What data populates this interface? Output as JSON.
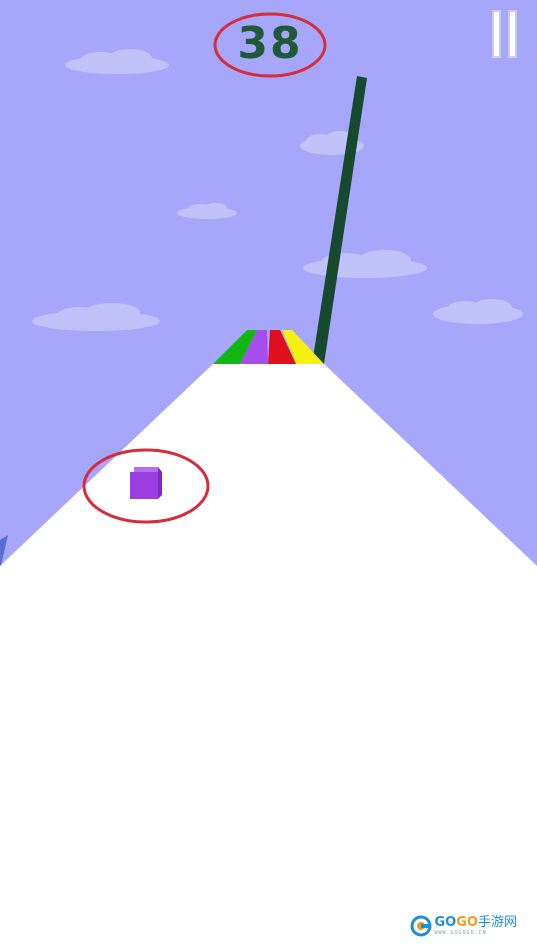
{
  "hud": {
    "score": "38",
    "score_color": "#1e5a3a",
    "highlight_color": "#d62d3a"
  },
  "colors": {
    "sky": "#a6a6fa",
    "cloud": "#c2c2fb",
    "track": "#ffffff",
    "pole": "#17492e",
    "player_cube": "#9b3de0",
    "lanes": [
      "#12b812",
      "#a54ded",
      "#e00f1e",
      "#f7f015"
    ]
  },
  "player": {
    "color_name": "purple"
  },
  "watermark": {
    "go_left": "GO",
    "go_right": "GO",
    "site_cn": "手游网",
    "sub": "WWW.GOGOGO.CN",
    "icon": "gogo-logo-icon"
  },
  "controls": {
    "pause_icon": "pause-icon"
  }
}
